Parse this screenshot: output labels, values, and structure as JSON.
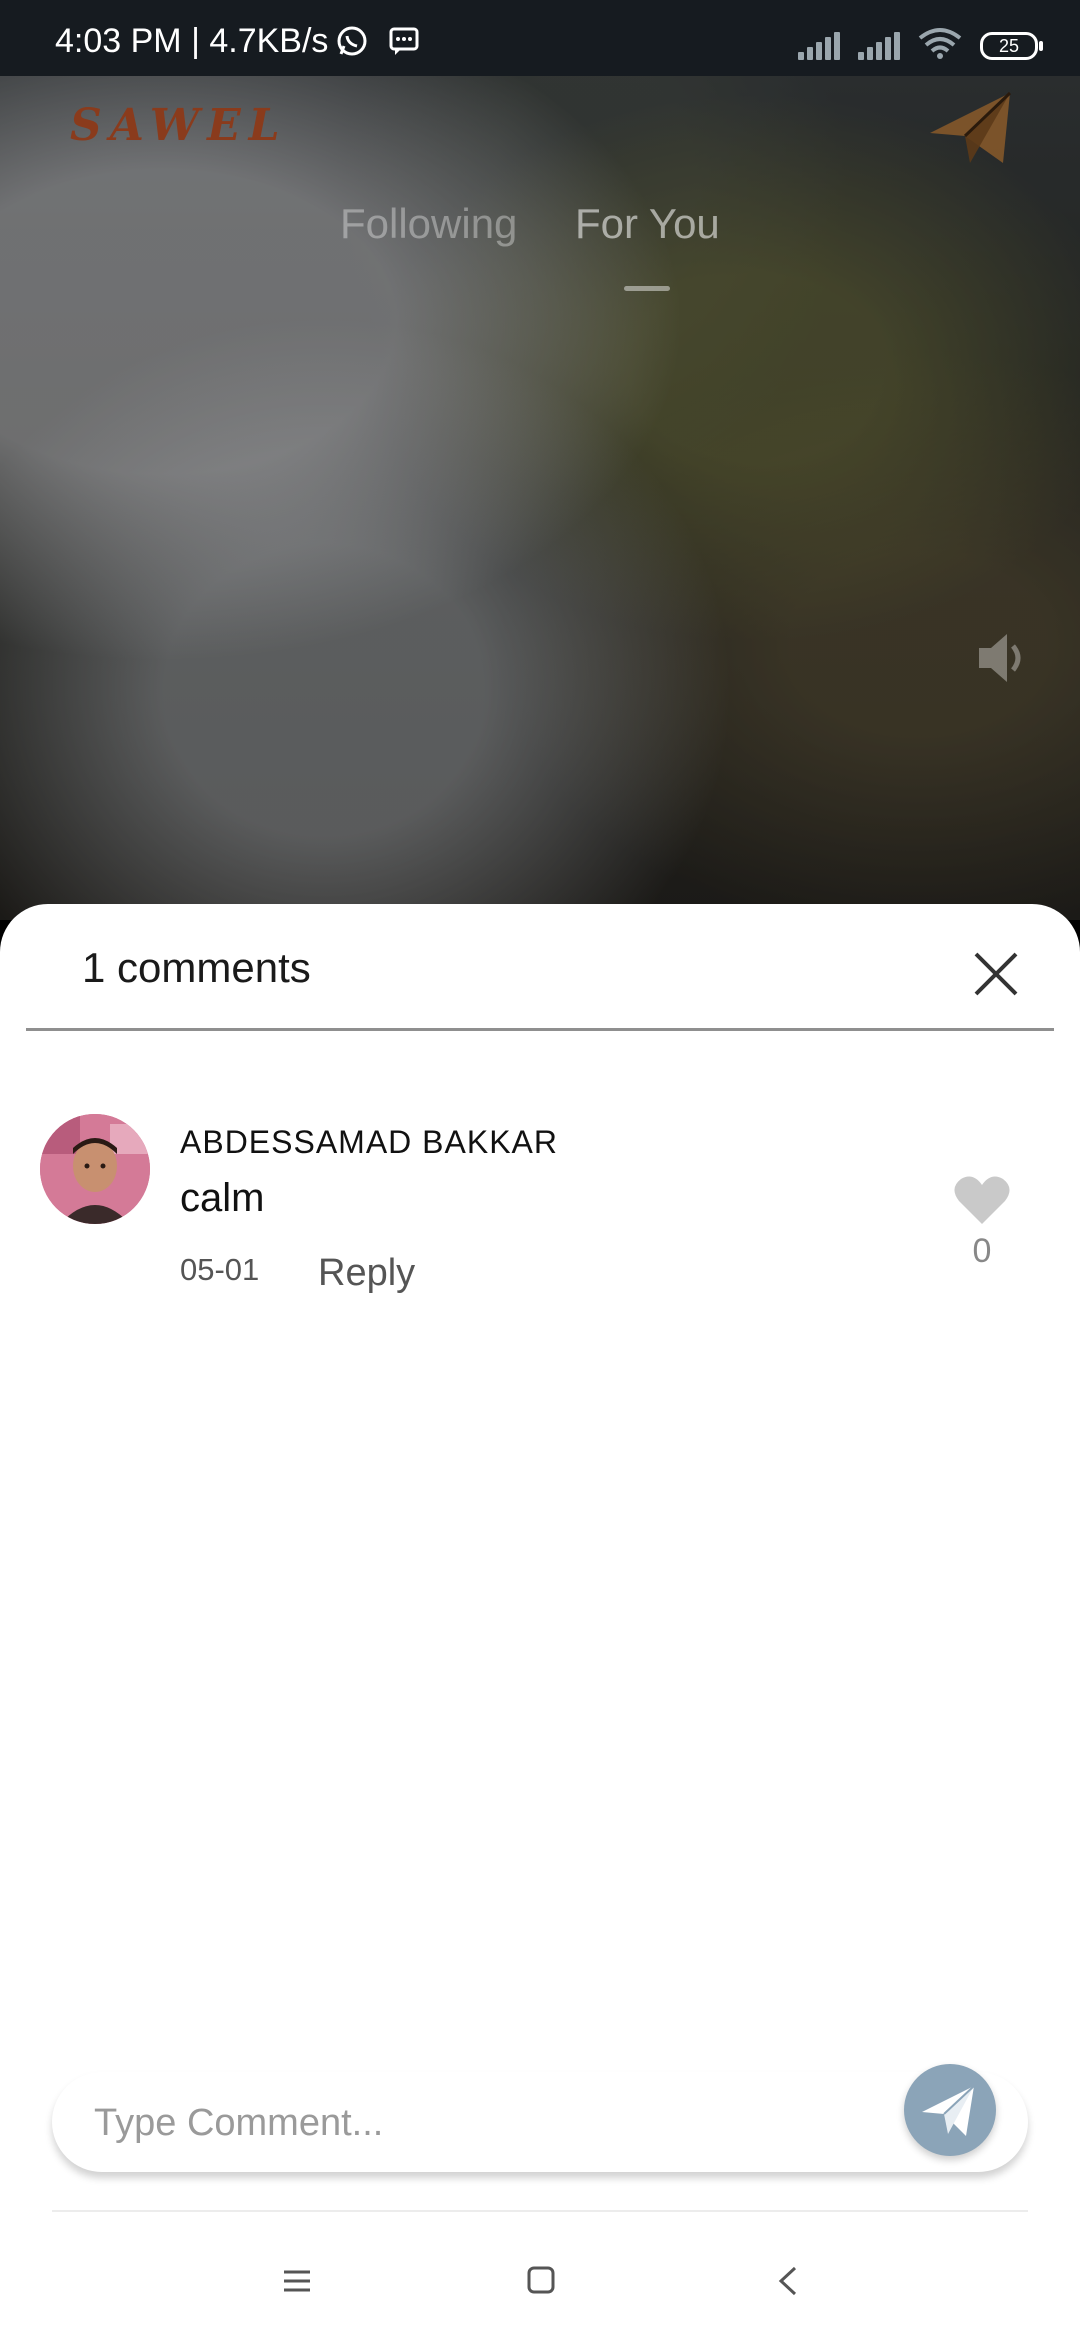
{
  "status_bar": {
    "time": "4:03 PM | 4.7KB/s",
    "battery": "25"
  },
  "header": {
    "logo": "SAWEL",
    "tabs": [
      {
        "label": "Following",
        "active": false
      },
      {
        "label": "For You",
        "active": true
      }
    ]
  },
  "comments_sheet": {
    "title": "1 comments",
    "comments": [
      {
        "author": "ABDESSAMAD BAKKAR",
        "text": "calm",
        "date": "05-01",
        "reply_label": "Reply",
        "likes": "0"
      }
    ],
    "input_placeholder": "Type Comment..."
  },
  "colors": {
    "logo": "#8a3b1c",
    "send_button": "#8ba4b8",
    "status_bar": "#161b20"
  },
  "icons": {
    "share": "paper-plane-icon",
    "volume": "volume-icon",
    "close": "close-icon",
    "like": "heart-icon",
    "send": "send-icon"
  }
}
